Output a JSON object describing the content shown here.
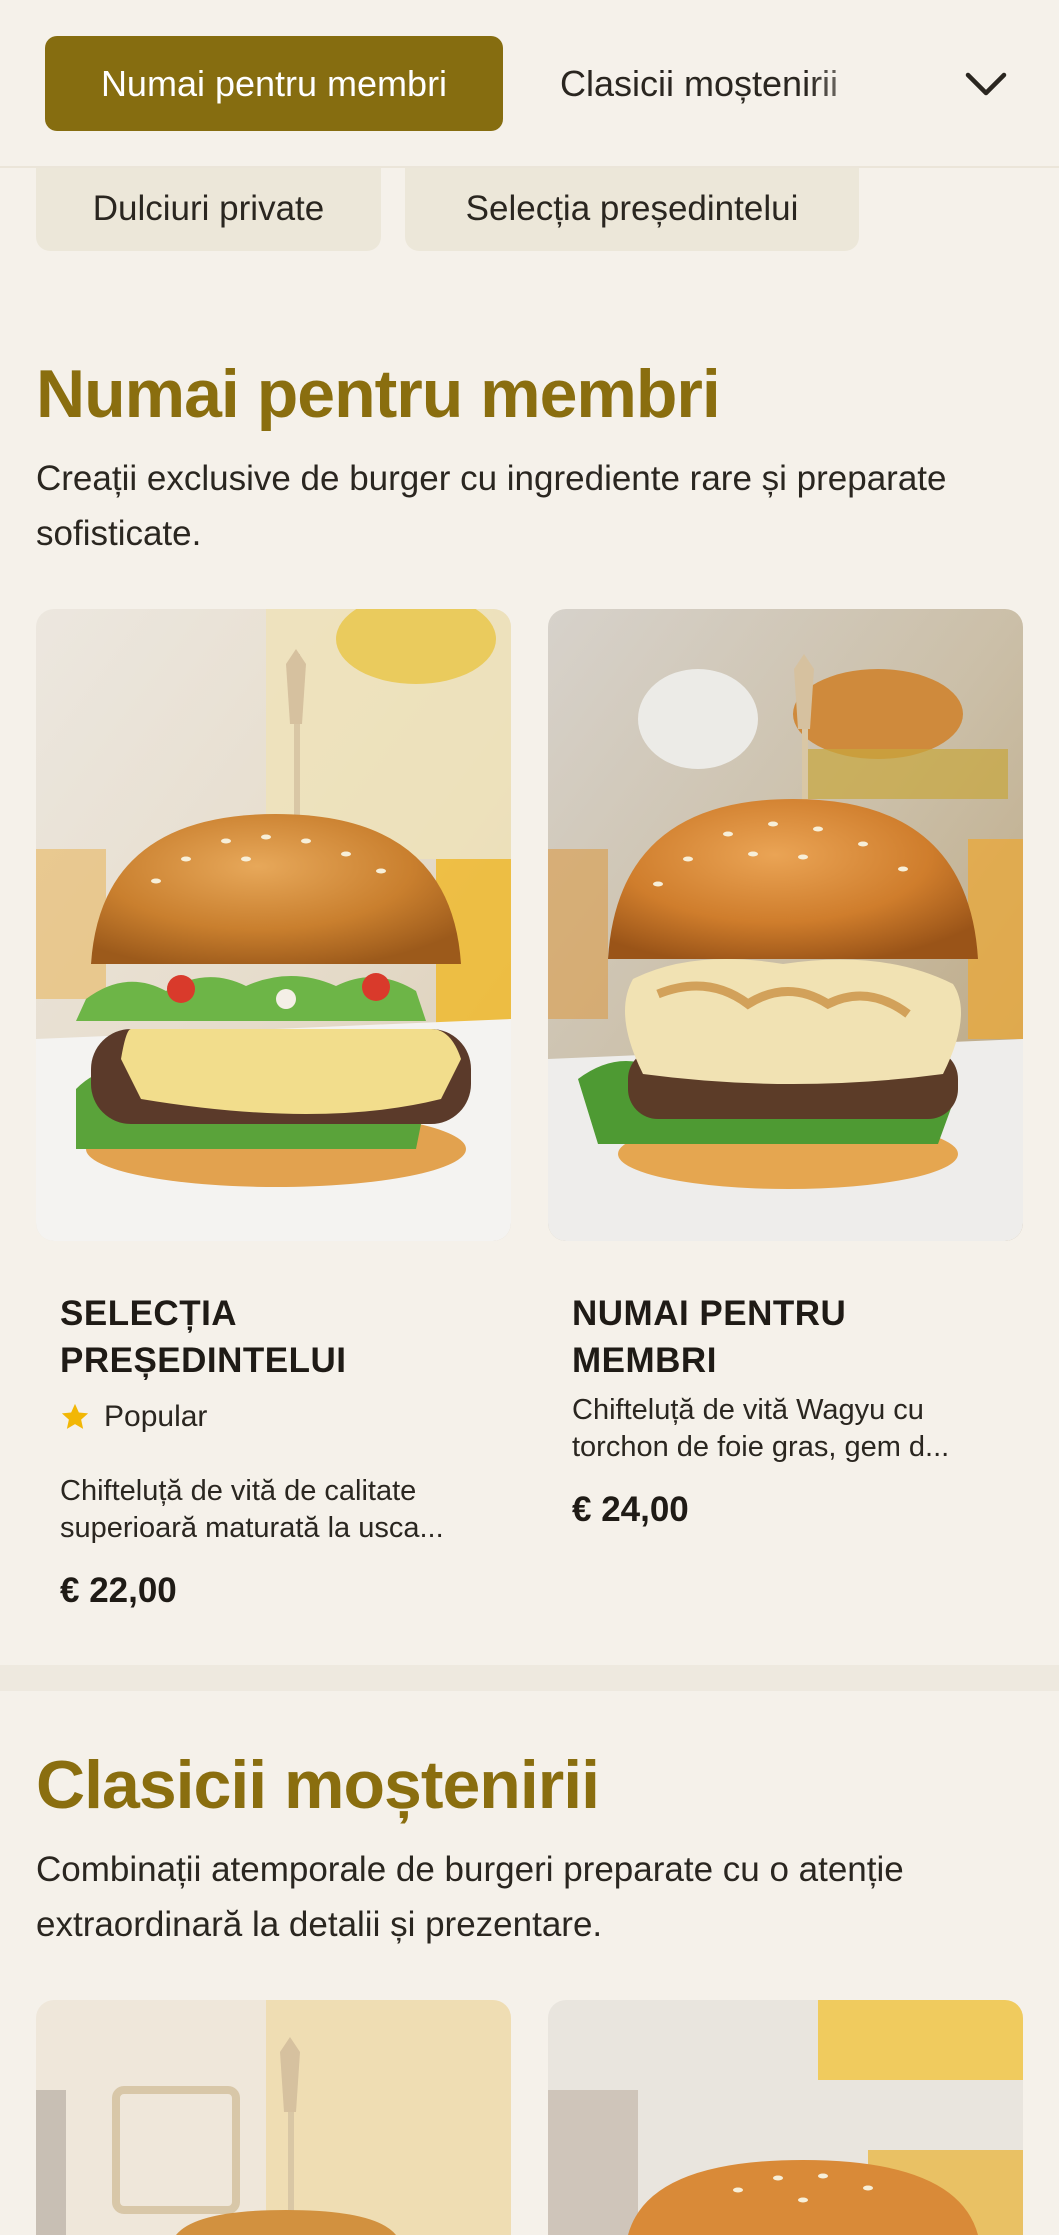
{
  "nav": {
    "active_tab": "Numai pentru membri",
    "next_tab": "Clasicii moștenirii",
    "secondary_tabs": [
      "Dulciuri private",
      "Selecția președintelui"
    ]
  },
  "sections": [
    {
      "title": "Numai pentru membri",
      "description": "Creații exclusive de burger cu ingrediente rare și preparate sofisticate.",
      "items": [
        {
          "name": "SELECȚIA PREȘEDINTELUI",
          "badge": "Popular",
          "description": "Chifteluță de vită de calitate superioară maturată la usca...",
          "price": "€ 22,00"
        },
        {
          "name": "NUMAI PENTRU MEMBRI",
          "description": "Chifteluță de vită Wagyu cu torchon de foie gras, gem d...",
          "price": "€ 24,00"
        }
      ]
    },
    {
      "title": "Clasicii moștenirii",
      "description": "Combinații atemporale de burgeri preparate cu o atenție extraordinară la detalii și prezentare."
    }
  ],
  "colors": {
    "accent": "#866d10",
    "heading": "#8a6e0f",
    "background": "#f5f1ea",
    "star": "#f2b705"
  },
  "icons": {
    "chevron": "chevron-down-icon",
    "star": "star-icon"
  }
}
